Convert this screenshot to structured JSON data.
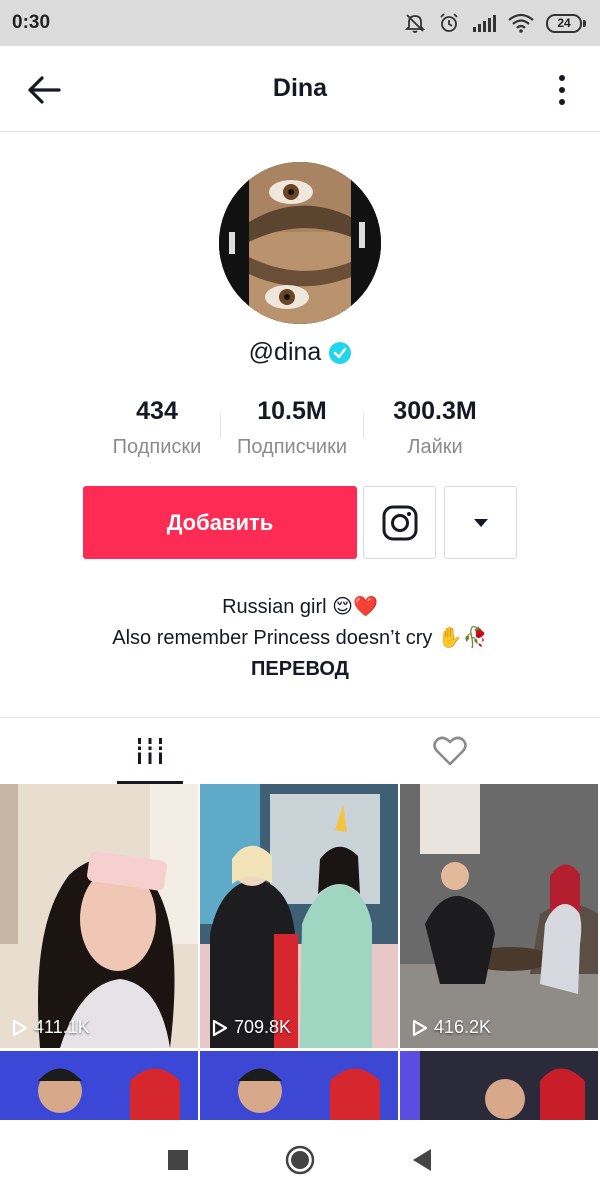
{
  "status_bar": {
    "time": "0:30",
    "battery": "24"
  },
  "header": {
    "title": "Dina"
  },
  "profile": {
    "username": "@dina",
    "stats": [
      {
        "value": "434",
        "label": "Подписки"
      },
      {
        "value": "10.5M",
        "label": "Подписчики"
      },
      {
        "value": "300.3M",
        "label": "Лайки"
      }
    ],
    "follow_label": "Добавить",
    "bio_line1": "Russian girl 😌❤️",
    "bio_line2": "Also remember Princess doesn’t cry ✋🥀",
    "translate_label": "ПЕРЕВОД"
  },
  "videos": [
    {
      "views": "411.1K"
    },
    {
      "views": "709.8K"
    },
    {
      "views": "416.2K"
    }
  ],
  "colors": {
    "accent": "#fe2c55",
    "verified": "#20d5ec",
    "text": "#161823",
    "secondary_text": "#8a8b91"
  }
}
